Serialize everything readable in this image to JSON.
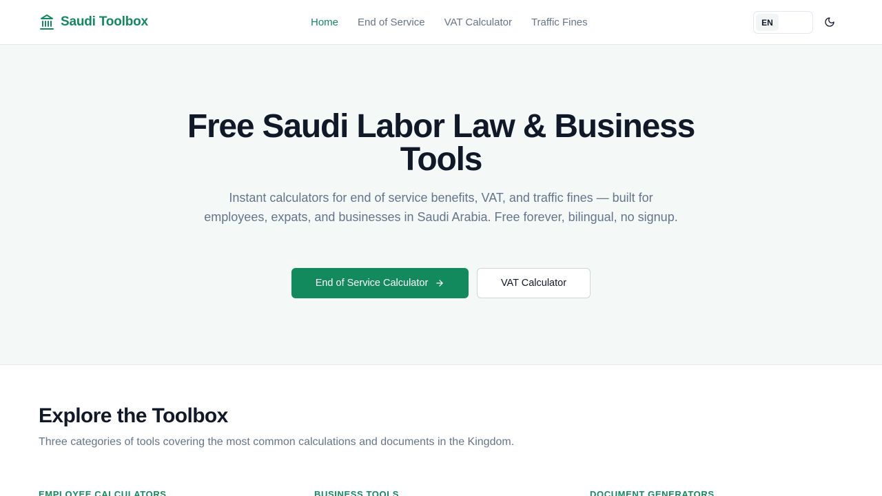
{
  "header": {
    "brand": "Saudi Toolbox",
    "nav": [
      {
        "label": "Home",
        "active": true
      },
      {
        "label": "End of Service",
        "active": false
      },
      {
        "label": "VAT Calculator",
        "active": false
      },
      {
        "label": "Traffic Fines",
        "active": false
      }
    ],
    "language": "EN",
    "theme_icon": "moon-icon"
  },
  "hero": {
    "title": "Free Saudi Labor Law & Business Tools",
    "subtitle": "Instant calculators for end of service benefits, VAT, and traffic fines — built for employees, expats, and businesses in Saudi Arabia. Free forever, bilingual, no signup.",
    "primary_cta": "End of Service Calculator",
    "secondary_cta": "VAT Calculator"
  },
  "explore": {
    "title": "Explore the Toolbox",
    "description": "Three categories of tools covering the most common calculations and documents in the Kingdom.",
    "categories": [
      "Employee Calculators",
      "Business Tools",
      "Document Generators"
    ]
  },
  "colors": {
    "brand": "#138a5d",
    "hero_bg": "#f4f8f7",
    "heading": "#111827",
    "muted": "#64748b"
  }
}
